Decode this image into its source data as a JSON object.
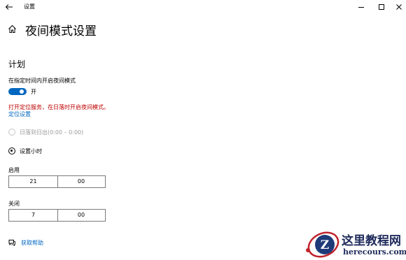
{
  "window": {
    "title": "设置",
    "controls": {
      "minimize": "minimize-icon",
      "maximize": "maximize-icon",
      "close": "close-icon"
    }
  },
  "header": {
    "title": "夜间模式设置",
    "home_icon": "home-icon",
    "back_icon": "back-arrow-icon"
  },
  "schedule": {
    "section_title": "计划",
    "toggle_label": "在指定时间内开启夜间模式",
    "toggle_state": "开",
    "toggle_on": true,
    "warning": "打开定位服务，在日落时开启夜间模式。",
    "location_link": "定位设置",
    "options": [
      {
        "label": "日落到日出(0:00 – 0:00)",
        "selected": false,
        "enabled": false
      },
      {
        "label": "设置小时",
        "selected": true,
        "enabled": true
      }
    ]
  },
  "turn_on": {
    "label": "启用",
    "hour": "21",
    "minute": "00"
  },
  "turn_off": {
    "label": "关闭",
    "hour": "7",
    "minute": "00"
  },
  "help": {
    "label": "获取帮助",
    "icon": "help-chat-icon"
  },
  "watermark": {
    "cn": "这里教程网",
    "en": "herecours.com"
  },
  "colors": {
    "accent": "#0067c0",
    "warning": "#c00000",
    "watermark": "#1e2a5a"
  }
}
